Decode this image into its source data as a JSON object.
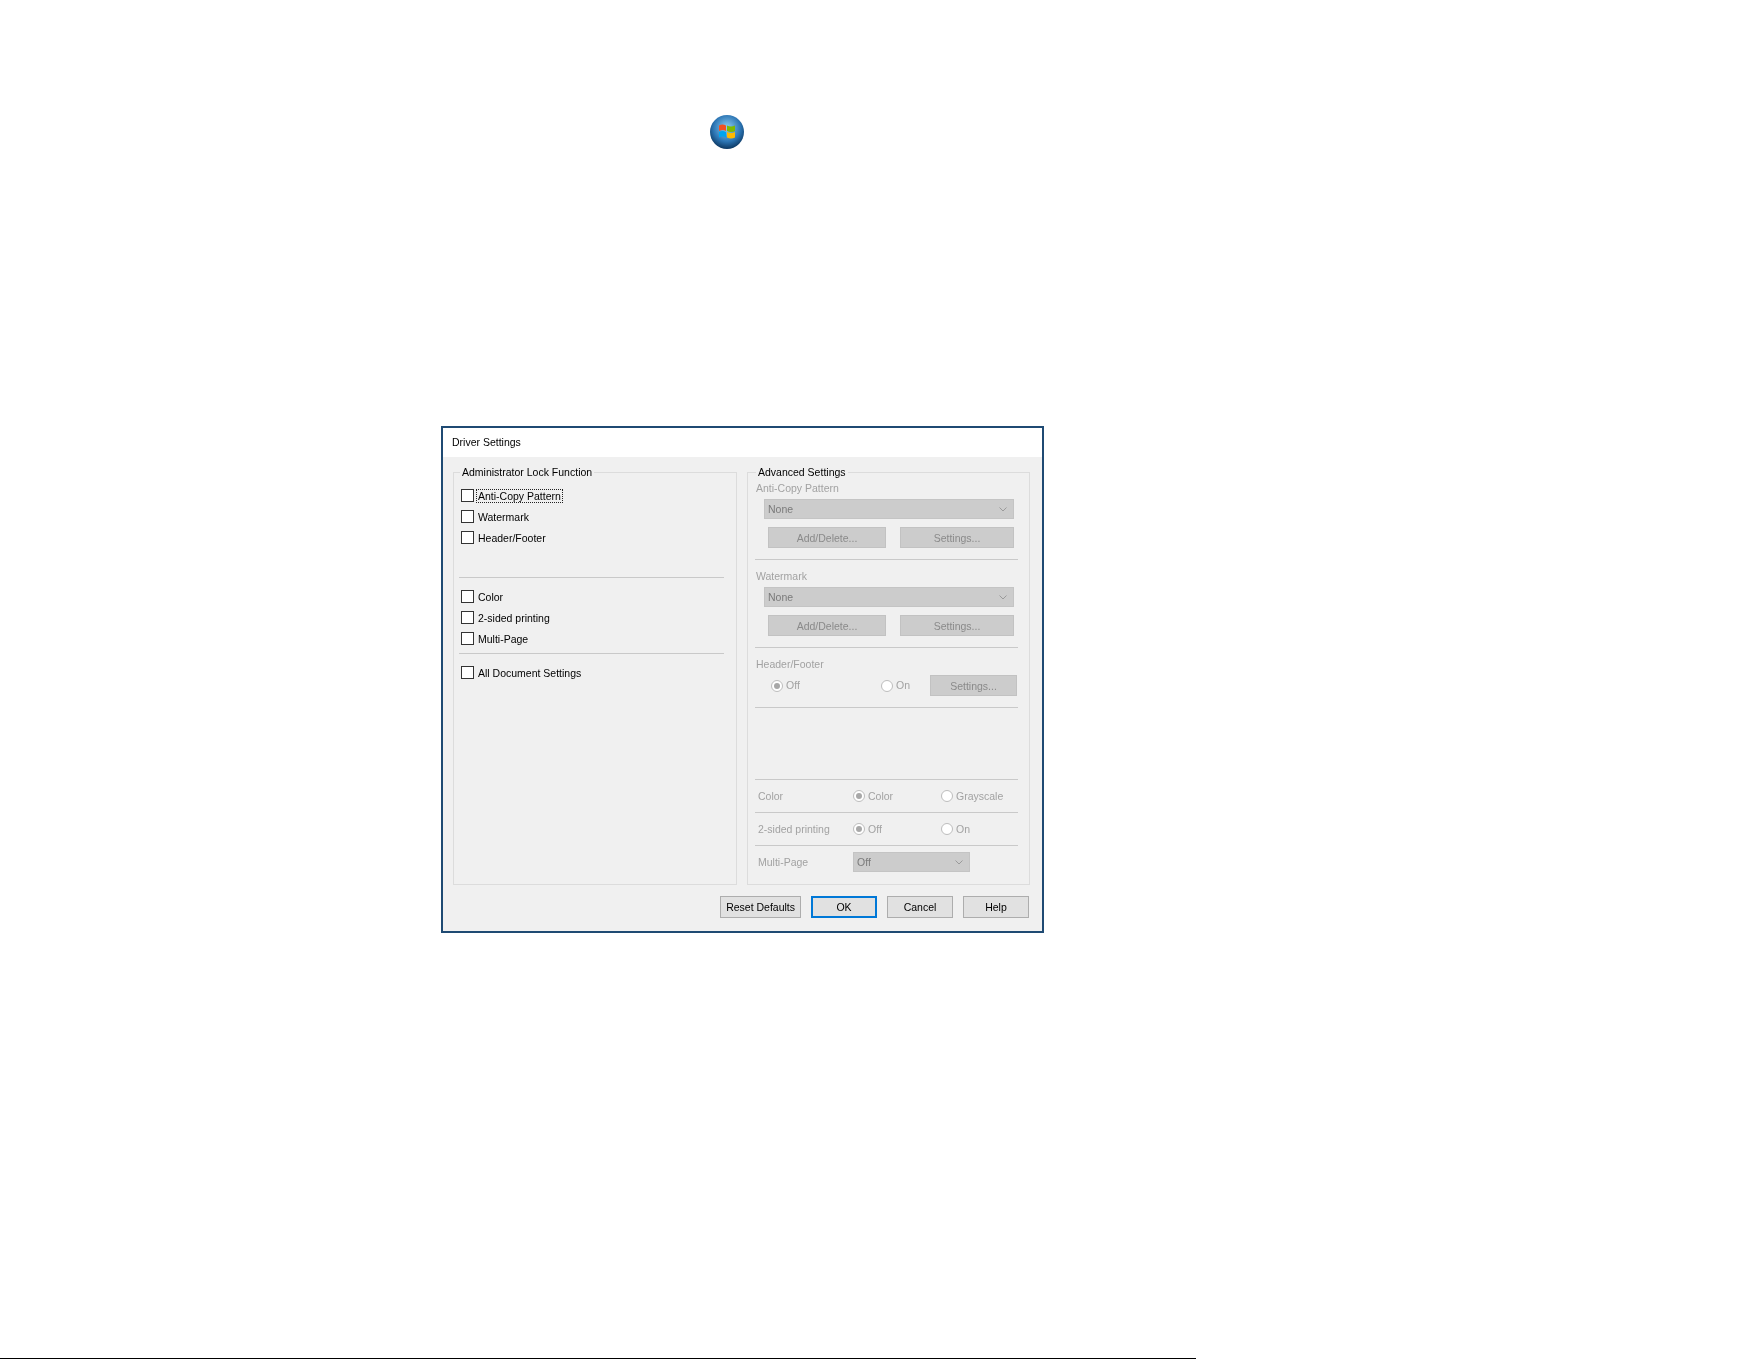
{
  "dialog": {
    "title": "Driver Settings",
    "lock_function": {
      "title": "Administrator Lock Function",
      "sections": [
        {
          "items": [
            {
              "label": "Anti-Copy Pattern",
              "checked": false,
              "focused": true
            },
            {
              "label": "Watermark",
              "checked": false,
              "focused": false
            },
            {
              "label": "Header/Footer",
              "checked": false,
              "focused": false
            }
          ]
        },
        {
          "items": [
            {
              "label": "Color",
              "checked": false,
              "focused": false
            },
            {
              "label": "2-sided printing",
              "checked": false,
              "focused": false
            },
            {
              "label": "Multi-Page",
              "checked": false,
              "focused": false
            }
          ]
        },
        {
          "items": [
            {
              "label": "All Document Settings",
              "checked": false,
              "focused": false
            }
          ]
        }
      ]
    },
    "advanced_settings": {
      "title": "Advanced Settings",
      "disabled": true,
      "sections": [
        {
          "kind": "select",
          "label": "Anti-Copy Pattern",
          "value": "None",
          "buttons": [
            "Add/Delete...",
            "Settings..."
          ]
        },
        {
          "kind": "select",
          "label": "Watermark",
          "value": "None",
          "buttons": [
            "Add/Delete...",
            "Settings..."
          ]
        },
        {
          "kind": "radio",
          "label": "Header/Footer",
          "options": [
            {
              "label": "Off",
              "selected": true
            },
            {
              "label": "On",
              "selected": false
            }
          ],
          "buttons": [
            "Settings..."
          ]
        }
      ],
      "rows": [
        {
          "kind": "radio",
          "label": "Color",
          "options": [
            {
              "label": "Color",
              "selected": true
            },
            {
              "label": "Grayscale",
              "selected": false
            }
          ]
        },
        {
          "kind": "radio",
          "label": "2-sided printing",
          "options": [
            {
              "label": "Off",
              "selected": true
            },
            {
              "label": "On",
              "selected": false
            }
          ]
        },
        {
          "kind": "select",
          "label": "Multi-Page",
          "value": "Off"
        }
      ]
    },
    "buttons": [
      {
        "label": "Reset Defaults",
        "default": false
      },
      {
        "label": "OK",
        "default": true
      },
      {
        "label": "Cancel",
        "default": false
      },
      {
        "label": "Help",
        "default": false
      }
    ]
  }
}
